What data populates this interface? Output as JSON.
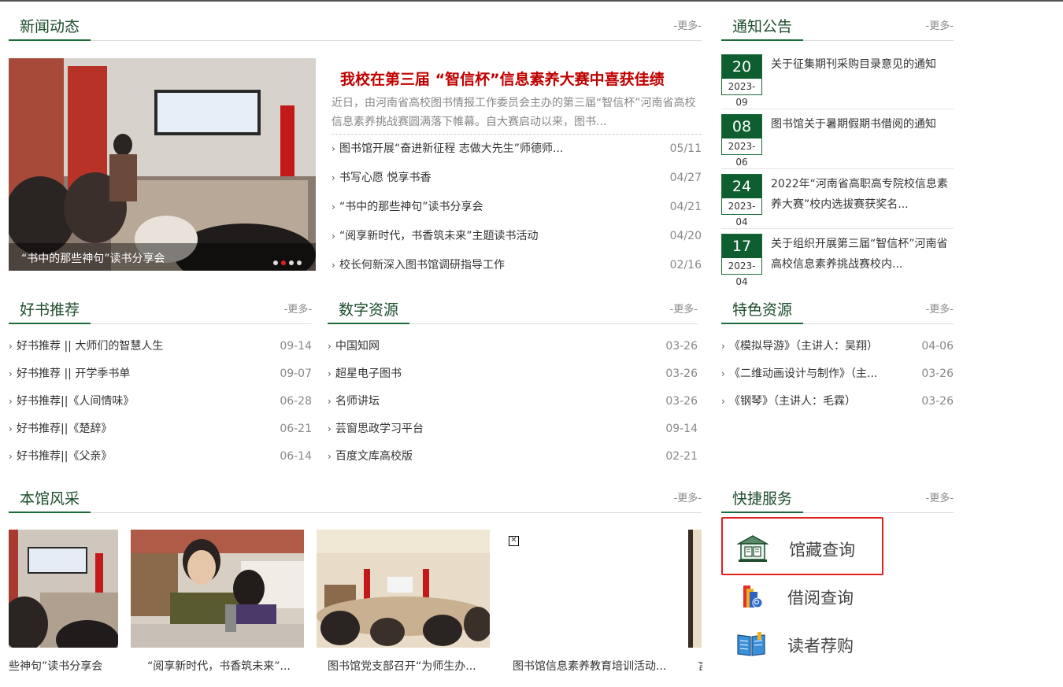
{
  "news": {
    "title": "新闻动态",
    "more": "-更多-",
    "headline": "我校在第三届 “智信杯”信息素养大赛中喜获佳绩",
    "summary": "近日，由河南省高校图书情报工作委员会主办的第三届“智信杯”河南省高校信息素养挑战赛圆满落下帷幕。自大赛启动以来，图书...",
    "slide_caption": "“书中的那些神句”读书分享会",
    "items": [
      {
        "title": "图书馆开展“奋进新征程 志做大先生”师德师...",
        "date": "05/11"
      },
      {
        "title": "书写心愿 悦享书香",
        "date": "04/27"
      },
      {
        "title": "“书中的那些神句”读书分享会",
        "date": "04/21"
      },
      {
        "title": "“阅享新时代，书香筑未来”主题读书活动",
        "date": "04/20"
      },
      {
        "title": "校长何新深入图书馆调研指导工作",
        "date": "02/16"
      }
    ]
  },
  "notices": {
    "title": "通知公告",
    "more": "-更多-",
    "items": [
      {
        "day": "20",
        "ym": "2023-09",
        "text": "关于征集期刊采购目录意见的通知"
      },
      {
        "day": "08",
        "ym": "2023-06",
        "text": "图书馆关于暑期假期书借阅的通知"
      },
      {
        "day": "24",
        "ym": "2023-04",
        "text": "2022年“河南省高职高专院校信息素养大赛”校内选拔赛获奖名..."
      },
      {
        "day": "17",
        "ym": "2023-04",
        "text": "关于组织开展第三届“智信杯”河南省高校信息素养挑战赛校内..."
      }
    ]
  },
  "books": {
    "title": "好书推荐",
    "more": "-更多-",
    "items": [
      {
        "title": "好书推荐 || 大师们的智慧人生",
        "date": "09-14"
      },
      {
        "title": "好书推荐 || 开学季书单",
        "date": "09-07"
      },
      {
        "title": "好书推荐||《人间情味》",
        "date": "06-28"
      },
      {
        "title": "好书推荐||《楚辞》",
        "date": "06-21"
      },
      {
        "title": "好书推荐||《父亲》",
        "date": "06-14"
      }
    ]
  },
  "digital": {
    "title": "数字资源",
    "more": "-更多-",
    "items": [
      {
        "title": "中国知网",
        "date": "03-26"
      },
      {
        "title": "超星电子图书",
        "date": "03-26"
      },
      {
        "title": "名师讲坛",
        "date": "03-26"
      },
      {
        "title": "芸窗思政学习平台",
        "date": "09-14"
      },
      {
        "title": "百度文库高校版",
        "date": "02-21"
      }
    ]
  },
  "featured": {
    "title": "特色资源",
    "more": "-更多-",
    "items": [
      {
        "title": "《模拟导游》（主讲人：吴翔）",
        "date": "04-06"
      },
      {
        "title": "《二维动画设计与制作》（主...",
        "date": "03-26"
      },
      {
        "title": "《钢琴》（主讲人：毛霖）",
        "date": "03-26"
      }
    ]
  },
  "gallery": {
    "title": "本馆风采",
    "more": "-更多-",
    "captions": [
      "些神句”读书分享会",
      "“阅享新时代，书香筑未来”...",
      "图书馆党支部召开“为师生办...",
      "图书馆信息素养教育培训活动...",
      "言"
    ]
  },
  "quick": {
    "title": "快捷服务",
    "more": "-更多-",
    "items": [
      {
        "label": "馆藏查询",
        "icon": "library-building-icon"
      },
      {
        "label": "借阅查询",
        "icon": "books-stack-icon"
      },
      {
        "label": "读者荐购",
        "icon": "open-book-icon"
      }
    ]
  },
  "colors": {
    "accent_green": "#0f5e2f",
    "headline_red": "#c00000",
    "highlight_box": "#e02020"
  }
}
